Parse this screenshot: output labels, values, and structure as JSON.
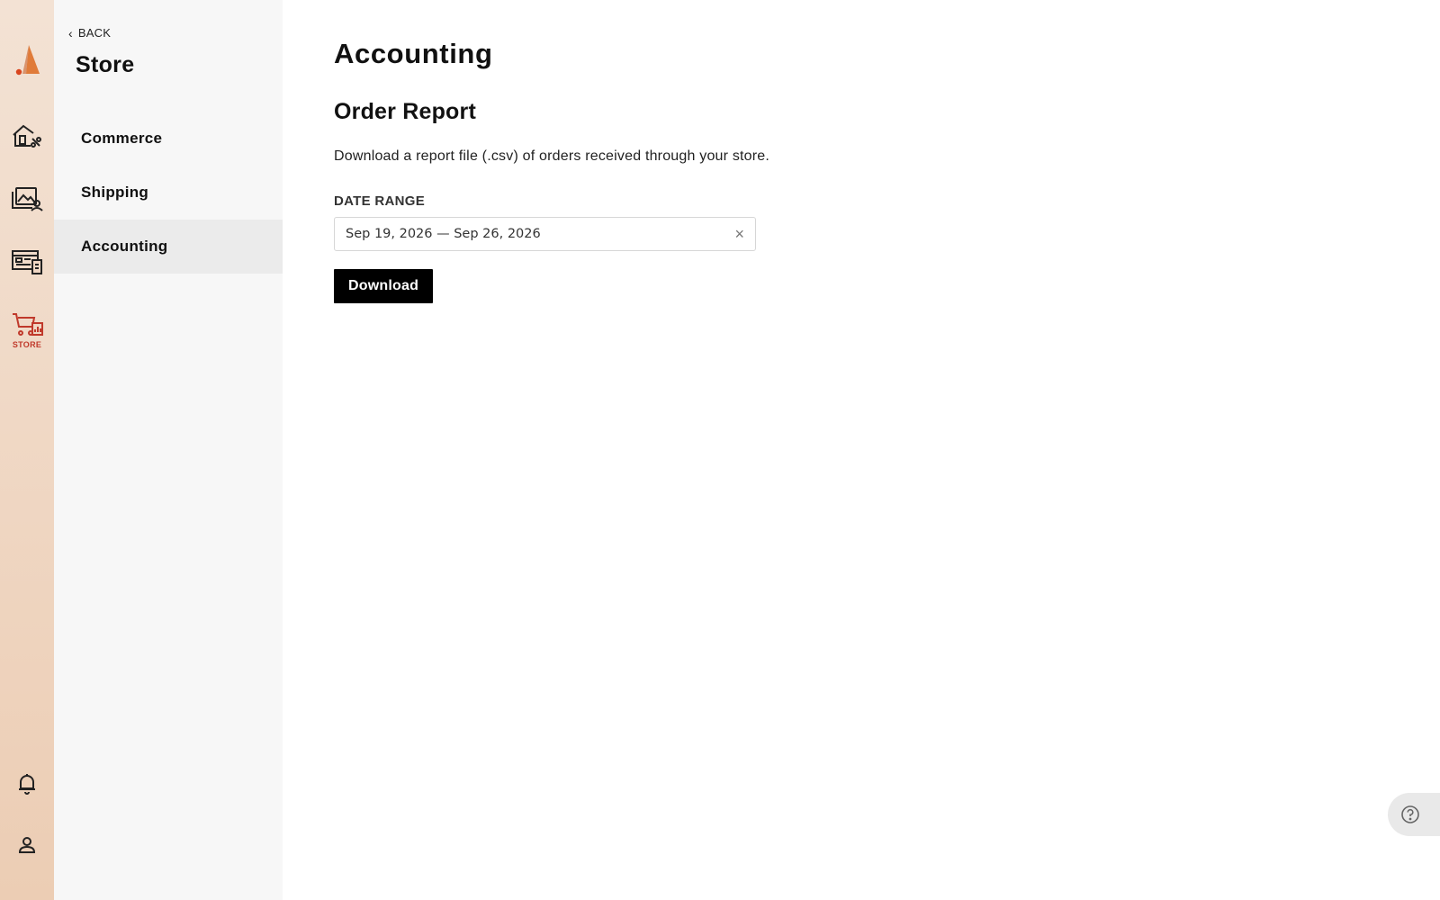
{
  "rail": {
    "items": [
      {
        "name": "logo",
        "icon": "brand-logo-icon"
      },
      {
        "name": "design",
        "icon": "house-edit-icon"
      },
      {
        "name": "media",
        "icon": "media-library-icon"
      },
      {
        "name": "pages",
        "icon": "layout-icon"
      },
      {
        "name": "store",
        "icon": "cart-chart-icon",
        "label": "STORE"
      }
    ],
    "bottom": [
      {
        "name": "notifications",
        "icon": "bell-icon"
      },
      {
        "name": "account",
        "icon": "user-icon"
      }
    ],
    "accent": "#c0392b"
  },
  "sidebar": {
    "back_label": "BACK",
    "title": "Store",
    "items": [
      {
        "label": "Commerce",
        "active": false
      },
      {
        "label": "Shipping",
        "active": false
      },
      {
        "label": "Accounting",
        "active": true
      }
    ]
  },
  "main": {
    "page_title": "Accounting",
    "section_title": "Order Report",
    "description": "Download a report file (.csv) of orders received through your store.",
    "date_range_label": "DATE RANGE",
    "date_range_value": "Sep 19, 2026 — Sep 26, 2026",
    "clear_glyph": "×",
    "download_label": "Download"
  },
  "help": {
    "icon": "help-circle-icon"
  }
}
